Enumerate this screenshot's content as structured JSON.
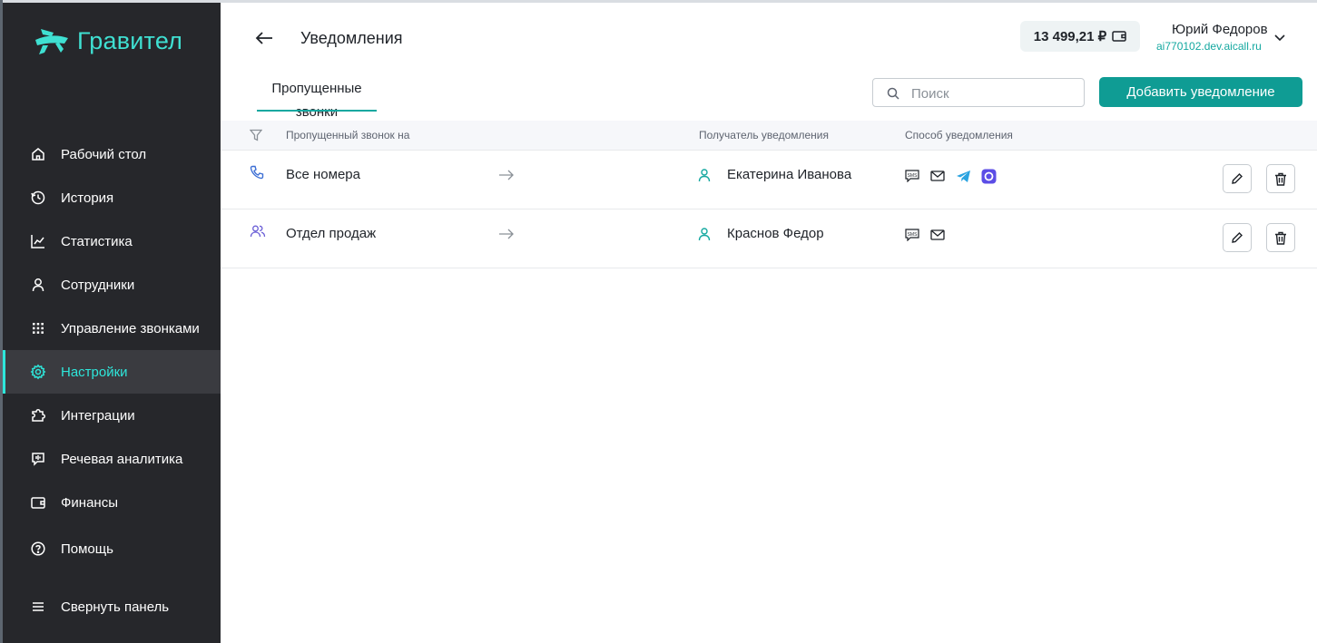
{
  "app": {
    "brand": "Гравител"
  },
  "colors": {
    "accent": "#0f9c94",
    "sidebar_bg": "#26272b",
    "active_item": "#2ee6da"
  },
  "sidebar": {
    "items": [
      {
        "label": "Рабочий стол",
        "icon": "home-icon"
      },
      {
        "label": "История",
        "icon": "history-icon"
      },
      {
        "label": "Статистика",
        "icon": "chart-icon"
      },
      {
        "label": "Сотрудники",
        "icon": "user-icon"
      },
      {
        "label": "Управление звонками",
        "icon": "dialpad-icon"
      },
      {
        "label": "Настройки",
        "icon": "gear-icon",
        "active": true
      },
      {
        "label": "Интеграции",
        "icon": "puzzle-icon"
      },
      {
        "label": "Речевая аналитика",
        "icon": "speech-icon"
      },
      {
        "label": "Финансы",
        "icon": "wallet-icon"
      },
      {
        "label": "Помощь",
        "icon": "help-icon"
      }
    ],
    "collapse_label": "Свернуть панель"
  },
  "header": {
    "title": "Уведомления",
    "balance": "13 499,21 ₽",
    "user_name": "Юрий Федоров",
    "user_domain": "ai770102.dev.aicall.ru"
  },
  "tabs": [
    {
      "label": "Пропущенные звонки",
      "active": true
    }
  ],
  "search": {
    "placeholder": "Поиск",
    "value": ""
  },
  "add_button": "Добавить уведомление",
  "table": {
    "columns": [
      "Пропущенный звонок на",
      "Получатель уведомления",
      "Способ уведомления"
    ],
    "rows": [
      {
        "source": "Все номера",
        "source_icon": "phone-icon",
        "recipient": "Екатерина Иванова",
        "methods": [
          "sms-icon",
          "email-icon",
          "telegram-icon",
          "max-messenger-icon"
        ]
      },
      {
        "source": "Отдел продаж",
        "source_icon": "users-icon",
        "recipient": "Краснов Федор",
        "methods": [
          "sms-icon",
          "email-icon"
        ]
      }
    ]
  }
}
